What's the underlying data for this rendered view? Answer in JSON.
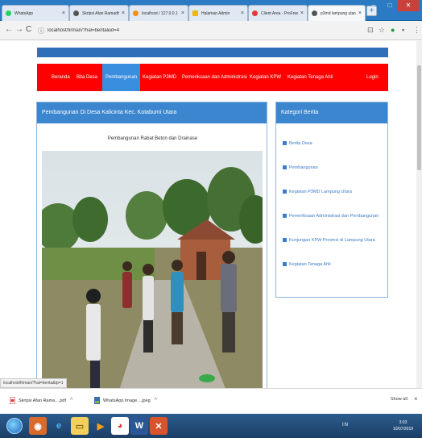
{
  "browser": {
    "tabs": [
      {
        "label": "WhatsApp",
        "color": "#25d366"
      },
      {
        "label": "Skripsi Afan Ramadhan",
        "color": "#555555"
      },
      {
        "label": "localhost / 127.0.0.1 / fi",
        "color": "#f29111"
      },
      {
        "label": "Halaman Admin",
        "color": "#f5b400"
      },
      {
        "label": "Client Area - ProFreeHo",
        "color": "#e03a3a"
      },
      {
        "label": "p3md lampung utara",
        "color": "#555555"
      }
    ],
    "url": "localhost/firman/?hal=berita&id=4"
  },
  "site": {
    "nav": [
      "Beranda",
      "Bita Desa",
      "Pembangunan",
      "Kegiatan P3MD",
      "Pemeriksaan dan Administrasi",
      "Kegiatan KPW",
      "Kegiatan Tenaga Ahli",
      "Login"
    ],
    "main_heading": "Pembangunan Di Desa Kalicinta Kec. Kotabumi Utara",
    "article_title": "Pembangunan Rabat Beton dan Drainase",
    "sidebar_heading": "Kategori Berita",
    "categories": [
      "Berita Desa",
      "Pembangunan",
      "Kegiatan P3MD Lampung Utara",
      "Pemeriksaan Administrasi dan Pembangunan",
      "Kunjungan KPW Provinsi di Lampung Utara",
      "Kegiatan Tenaga Ahli"
    ],
    "accent": "#3b86cf",
    "nav_color": "#ff0000"
  },
  "status_url": "localhost/firman/?hal=berita&tp=1",
  "downloads": {
    "items": [
      "Skripsi Afan Rama....pdf",
      "WhatsApp Image....jpeg"
    ],
    "show_all": "Show all"
  },
  "taskbar": {
    "tray": "IN",
    "time": "3:03",
    "date": "10/07/2019"
  }
}
